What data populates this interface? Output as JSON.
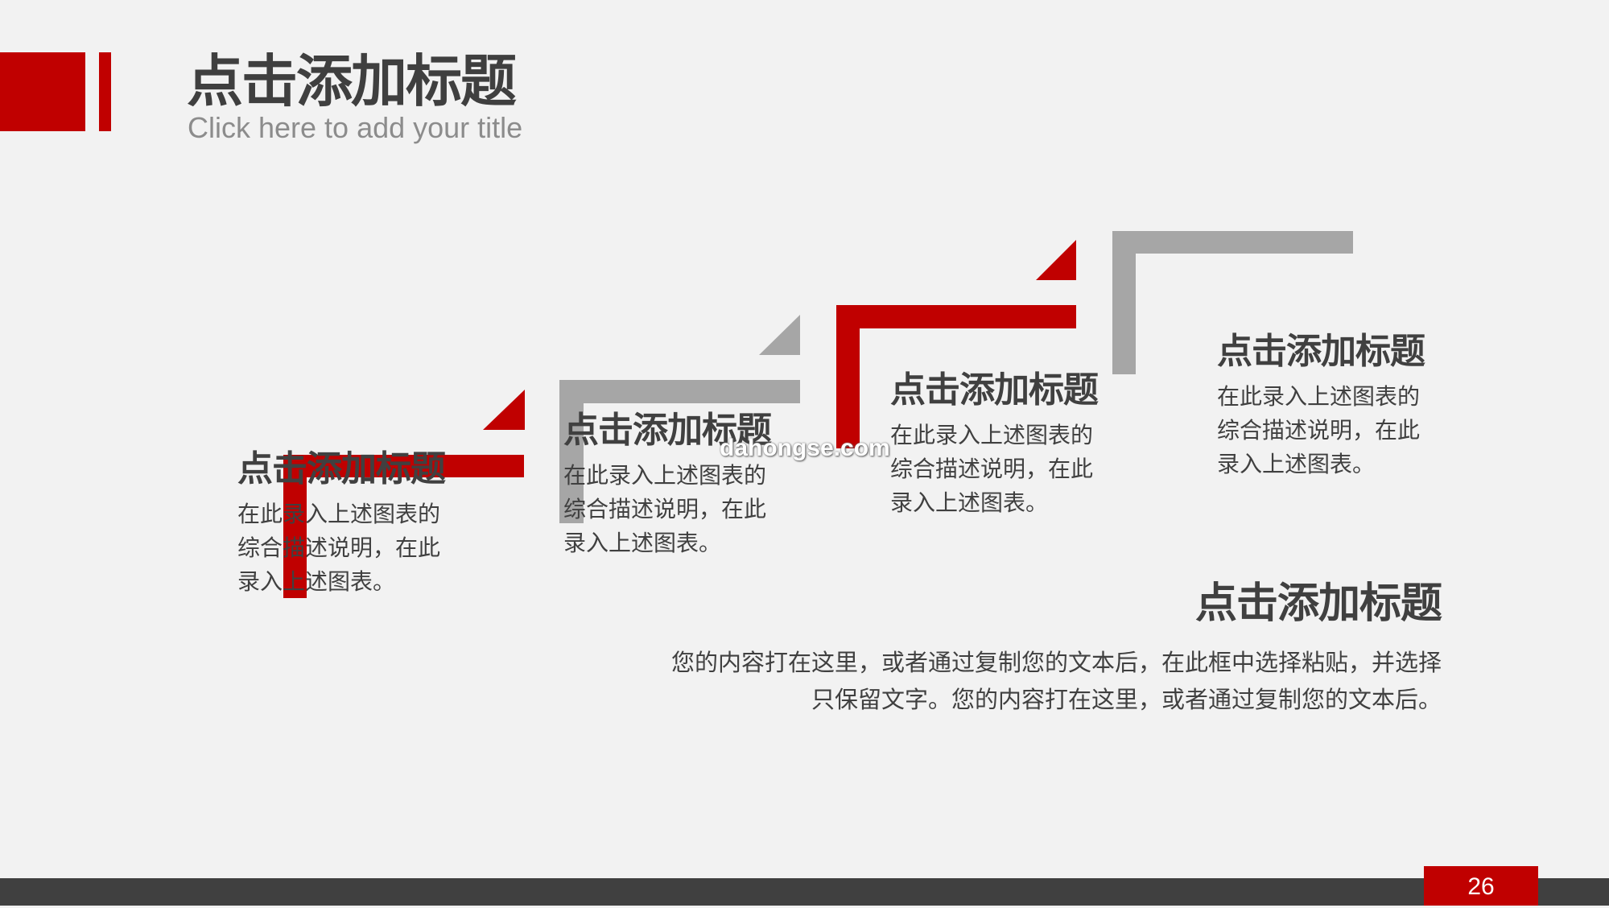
{
  "header": {
    "title": "点击添加标题",
    "subtitle": "Click here to add your title"
  },
  "steps": [
    {
      "title": "点击添加标题",
      "desc": "在此录入上述图表的\n综合描述说明，在此\n录入上述图表。"
    },
    {
      "title": "点击添加标题",
      "desc": "在此录入上述图表的\n综合描述说明，在此\n录入上述图表。"
    },
    {
      "title": "点击添加标题",
      "desc": "在此录入上述图表的\n综合描述说明，在此\n录入上述图表。"
    },
    {
      "title": "点击添加标题",
      "desc": "在此录入上述图表的\n综合描述说明，在此\n录入上述图表。"
    }
  ],
  "summary": {
    "title": "点击添加标题",
    "body": "您的内容打在这里，或者通过复制您的文本后，在此框中选择粘贴，并选择只保留文字。您的内容打在这里，或者通过复制您的文本后。"
  },
  "watermark": "dahongse.com",
  "footer": {
    "page_number": "26"
  },
  "colors": {
    "accent": "#c00000",
    "secondary": "#a6a6a6",
    "text": "#404040",
    "background": "#f2f2f2",
    "footer_bar": "#404040"
  }
}
